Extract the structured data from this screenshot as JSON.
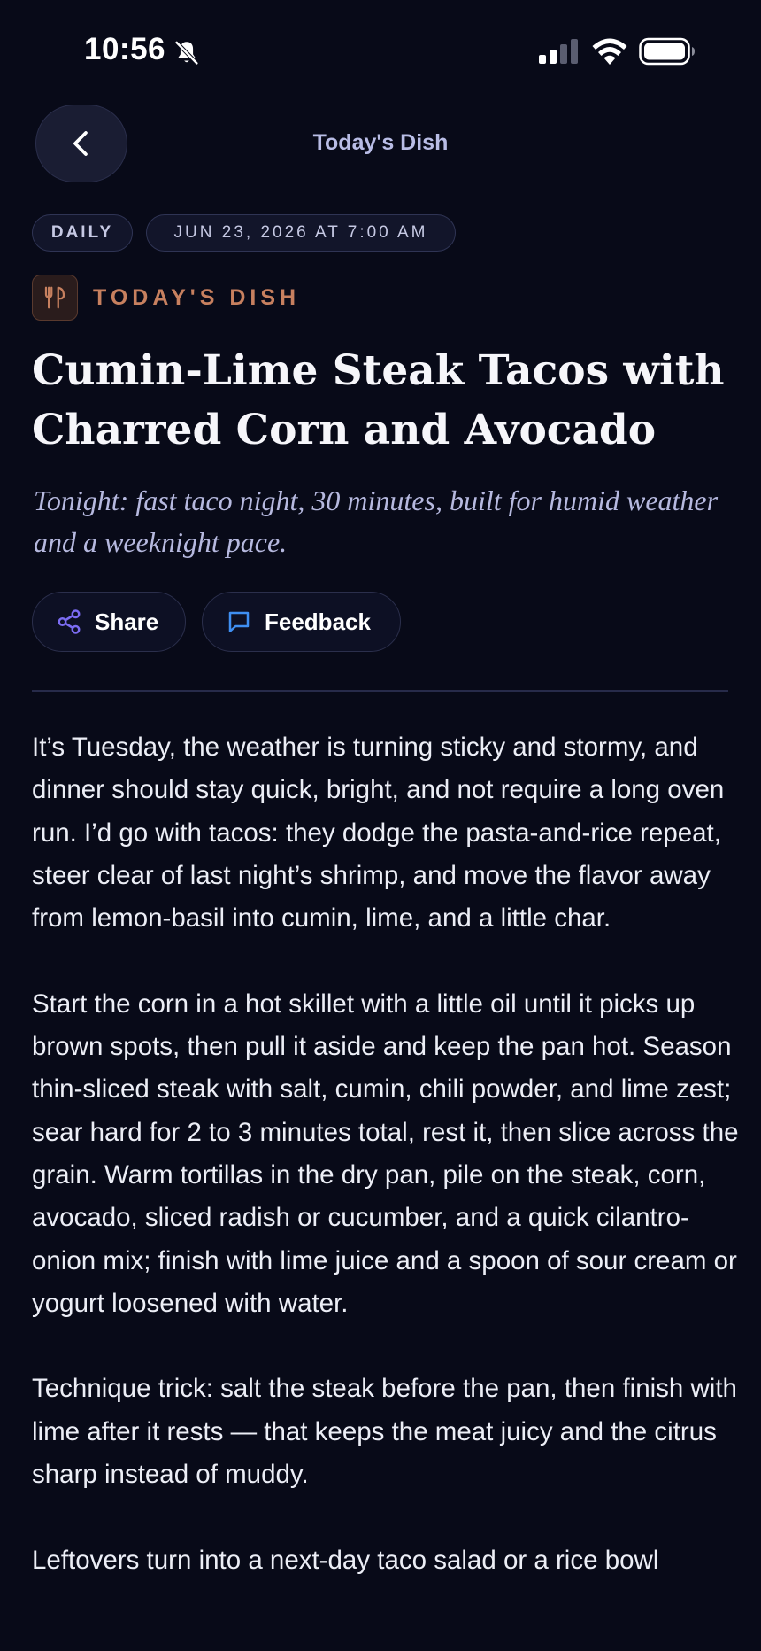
{
  "status_bar": {
    "time": "10:56",
    "icons": [
      "bell-slash-icon",
      "signal-icon",
      "wifi-icon",
      "battery-icon"
    ]
  },
  "nav": {
    "back_icon": "chevron-left-icon",
    "title": "Today's Dish"
  },
  "chips": {
    "daily": "DAILY",
    "date": "JUN 23, 2026 AT 7:00 AM"
  },
  "category": {
    "icon": "fork-knife-icon",
    "label": "TODAY'S DISH"
  },
  "headline": "Cumin-Lime Steak Tacos with Charred Corn and Avocado",
  "subtitle": "Tonight: fast taco night, 30 minutes, built for humid weather and a weeknight pace.",
  "actions": {
    "share_label": "Share",
    "feedback_label": "Feedback"
  },
  "article": {
    "paragraphs": [
      "It’s Tuesday, the weather is turning sticky and stormy, and dinner should stay quick, bright, and not require a long oven run. I’d go with tacos: they dodge the pasta-and-rice repeat, steer clear of last night’s shrimp, and move the flavor away from lemon-basil into cumin, lime, and a little char.",
      "Start the corn in a hot skillet with a little oil until it picks up brown spots, then pull it aside and keep the pan hot. Season thin-sliced steak with salt, cumin, chili powder, and lime zest; sear hard for 2 to 3 minutes total, rest it, then slice across the grain. Warm tortillas in the dry pan, pile on the steak, corn, avocado, sliced radish or cucumber, and a quick cilantro-onion mix; finish with lime juice and a spoon of sour cream or yogurt loosened with water.",
      "Technique trick: salt the steak before the pan, then finish with lime after it rests — that keeps the meat juicy and the citrus sharp instead of muddy.",
      "Leftovers turn into a next-day taco salad or a rice bowl"
    ]
  },
  "colors": {
    "background": "#080a18",
    "accent_category": "#c7805f",
    "accent_share_icon": "#7b6cf2",
    "accent_feedback_icon": "#3f8ff2",
    "nav_title": "#b9bde6"
  }
}
